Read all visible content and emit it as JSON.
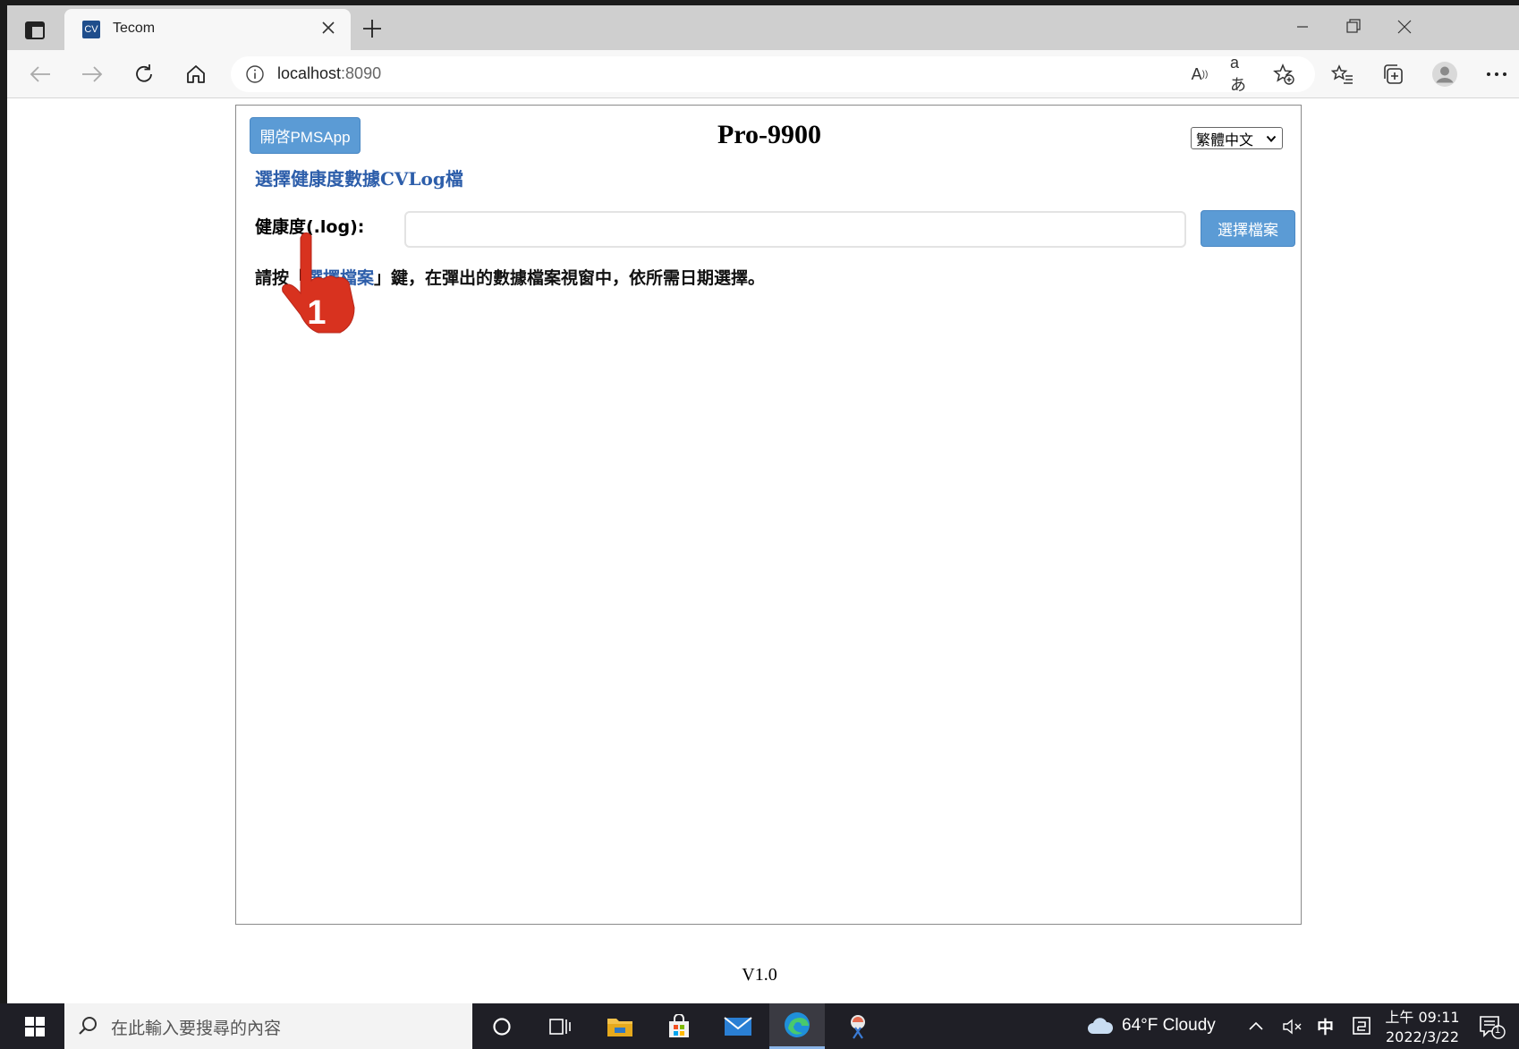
{
  "browser": {
    "tab_title": "Tecom",
    "tab_favicon_text": "CV",
    "address": "localhost",
    "address_port": ":8090"
  },
  "page": {
    "open_button_label": "開啓PMSApp",
    "title": "Pro-9900",
    "language_selected": "繁體中文",
    "link_heading": "選擇健康度數據CVLog檔",
    "field_label": "健康度(.log):",
    "file_input_value": "",
    "choose_button_label": "選擇檔案",
    "instruction_prefix": "請按「",
    "instruction_highlight": "選擇檔案",
    "instruction_suffix": "」鍵，在彈出的數據檔案視窗中，依所需日期選擇。",
    "pointer_step": "1",
    "version": "V1.0"
  },
  "taskbar": {
    "search_placeholder": "在此輸入要搜尋的內容",
    "weather": "64°F  Cloudy",
    "ime": "中",
    "time": "上午 09:11",
    "date": "2022/3/22",
    "notification_count": "1"
  },
  "colors": {
    "accent_button": "#5b9bd5",
    "link": "#2d5eaa",
    "pointer": "#d8321f"
  }
}
